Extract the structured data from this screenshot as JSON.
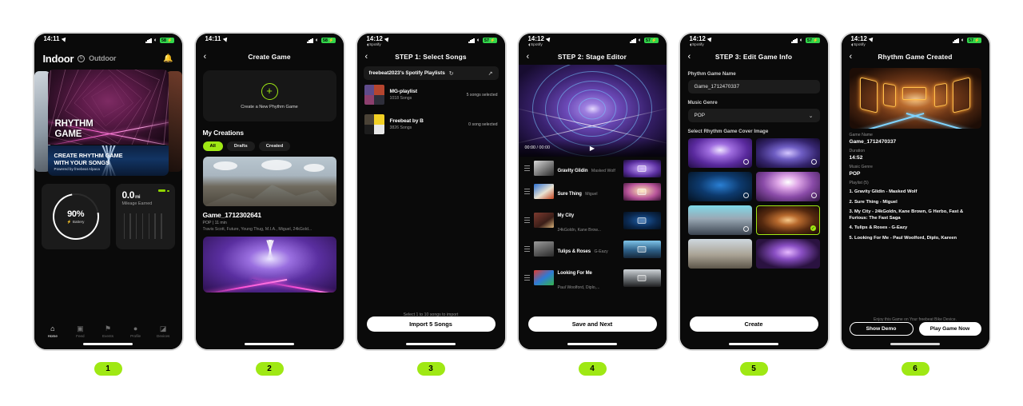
{
  "badges": [
    "1",
    "2",
    "3",
    "4",
    "5",
    "6"
  ],
  "status": {
    "time_1": "14:11",
    "time_2": "14:11",
    "time_3": "14:12",
    "time_4": "14:12",
    "time_5": "14:12",
    "time_6": "14:12",
    "spotify_label": "Spotify",
    "battery_1": "58",
    "battery_2": "58",
    "battery_3": "57",
    "battery_4": "57",
    "battery_5": "57",
    "battery_6": "57"
  },
  "screen1": {
    "mode_active": "Indoor",
    "mode_inactive": "Outdoor",
    "hero_title_line1": "RHYTHM",
    "hero_title_line2": "GAME",
    "banner_line1": "CREATE RHYTHM GAME",
    "banner_line2": "WITH YOUR SONGS",
    "banner_sub": "Powered by freebeat Alpaca",
    "battery_pct": "90%",
    "battery_label": "Battery",
    "mileage_value": "0.0",
    "mileage_unit": "mi",
    "mileage_label": "Mileage Earned",
    "tabs": [
      {
        "label": "Home",
        "icon": "home-icon",
        "active": true
      },
      {
        "label": "Feed",
        "icon": "feed-icon",
        "active": false
      },
      {
        "label": "Events",
        "icon": "events-flag-icon",
        "active": false
      },
      {
        "label": "Profile",
        "icon": "profile-person-icon",
        "active": false
      },
      {
        "label": "Devices",
        "icon": "bike-icon",
        "active": false
      }
    ]
  },
  "screen2": {
    "nav_title": "Create Game",
    "create_card_label": "Create a New Phythm Game",
    "section_title": "My Creations",
    "filters": [
      {
        "label": "All",
        "active": true
      },
      {
        "label": "Drafts",
        "active": false
      },
      {
        "label": "Created",
        "active": false
      }
    ],
    "game_name": "Game_1712302641",
    "game_meta": "POP | 11 min",
    "game_artists": "Travis Scott, Future, Young Thug, M.I.A., Miguel, 24kGold..."
  },
  "screen3": {
    "nav_title": "STEP 1: Select Songs",
    "search_label": "freebeat2023's Spotify Playlists",
    "playlists": [
      {
        "name": "MG-playlist",
        "songs": "1018 Songs",
        "selected": "5 songs selected"
      },
      {
        "name": "Freebeat by B",
        "songs": "3826 Songs",
        "selected": "0 song selected"
      }
    ],
    "hint": "Select 1 to 10 songs to import",
    "cta": "Import 5 Songs"
  },
  "screen4": {
    "nav_title": "STEP 2: Stage Editor",
    "time_current": "00:00",
    "time_total": "00:00",
    "songs": [
      {
        "title": "Gravity Glidin",
        "artist": "Masked Wolf"
      },
      {
        "title": "Sure Thing",
        "artist": "Miguel"
      },
      {
        "title": "My City",
        "artist": "24kGoldn, Kane Brow..."
      },
      {
        "title": "Tulips & Roses",
        "artist": "G-Eazy"
      },
      {
        "title": "Looking For Me",
        "artist": "Paul Woolford, Diplo,..."
      }
    ],
    "cta": "Save and Next"
  },
  "screen5": {
    "nav_title": "STEP 3: Edit Game Info",
    "name_label": "Phythm Game Name",
    "name_value": "Game_1712470337",
    "genre_label": "Music Genre",
    "genre_value": "POP",
    "cover_label": "Select Rhythm Game Cover Image",
    "covers": [
      {
        "id": "cover-neon-purple",
        "selected": false
      },
      {
        "id": "cover-blue-tunnel-rings",
        "selected": false
      },
      {
        "id": "cover-dark-blue-road",
        "selected": false
      },
      {
        "id": "cover-pink-stage-lights",
        "selected": false
      },
      {
        "id": "cover-ice-canyon",
        "selected": false
      },
      {
        "id": "cover-orange-neon-tunnel",
        "selected": true
      },
      {
        "id": "cover-desert-mountain",
        "selected": false
      },
      {
        "id": "cover-pink-blue-arch",
        "selected": false
      }
    ],
    "cta": "Create"
  },
  "screen6": {
    "nav_title": "Rhythm Game Created",
    "name_label": "Game Name",
    "name_value": "Game_1712470337",
    "duration_label": "Duration",
    "duration_value": "14:52",
    "genre_label": "Music Genre",
    "genre_value": "POP",
    "playlist_label": "Playlist (5)",
    "playlist": [
      "1. Gravity Glidin - Masked Wolf",
      "2. Sure Thing - Miguel",
      "3. My City - 24kGoldn, Kane Brown, G Herbo, Fast & Furious: The Fast Saga",
      "4. Tulips & Roses - G-Eazy",
      "5. Looking For Me - Paul Woolford, Diplo, Kareen"
    ],
    "footer_note": "Enjoy this Game on Your freebeat Bike Device.",
    "btn_demo": "Show Demo",
    "btn_play": "Play Game Now"
  },
  "colors": {
    "accent_green": "#9fe814",
    "battery_green": "#32d74b",
    "screen_bg": "#0a0a0a"
  }
}
